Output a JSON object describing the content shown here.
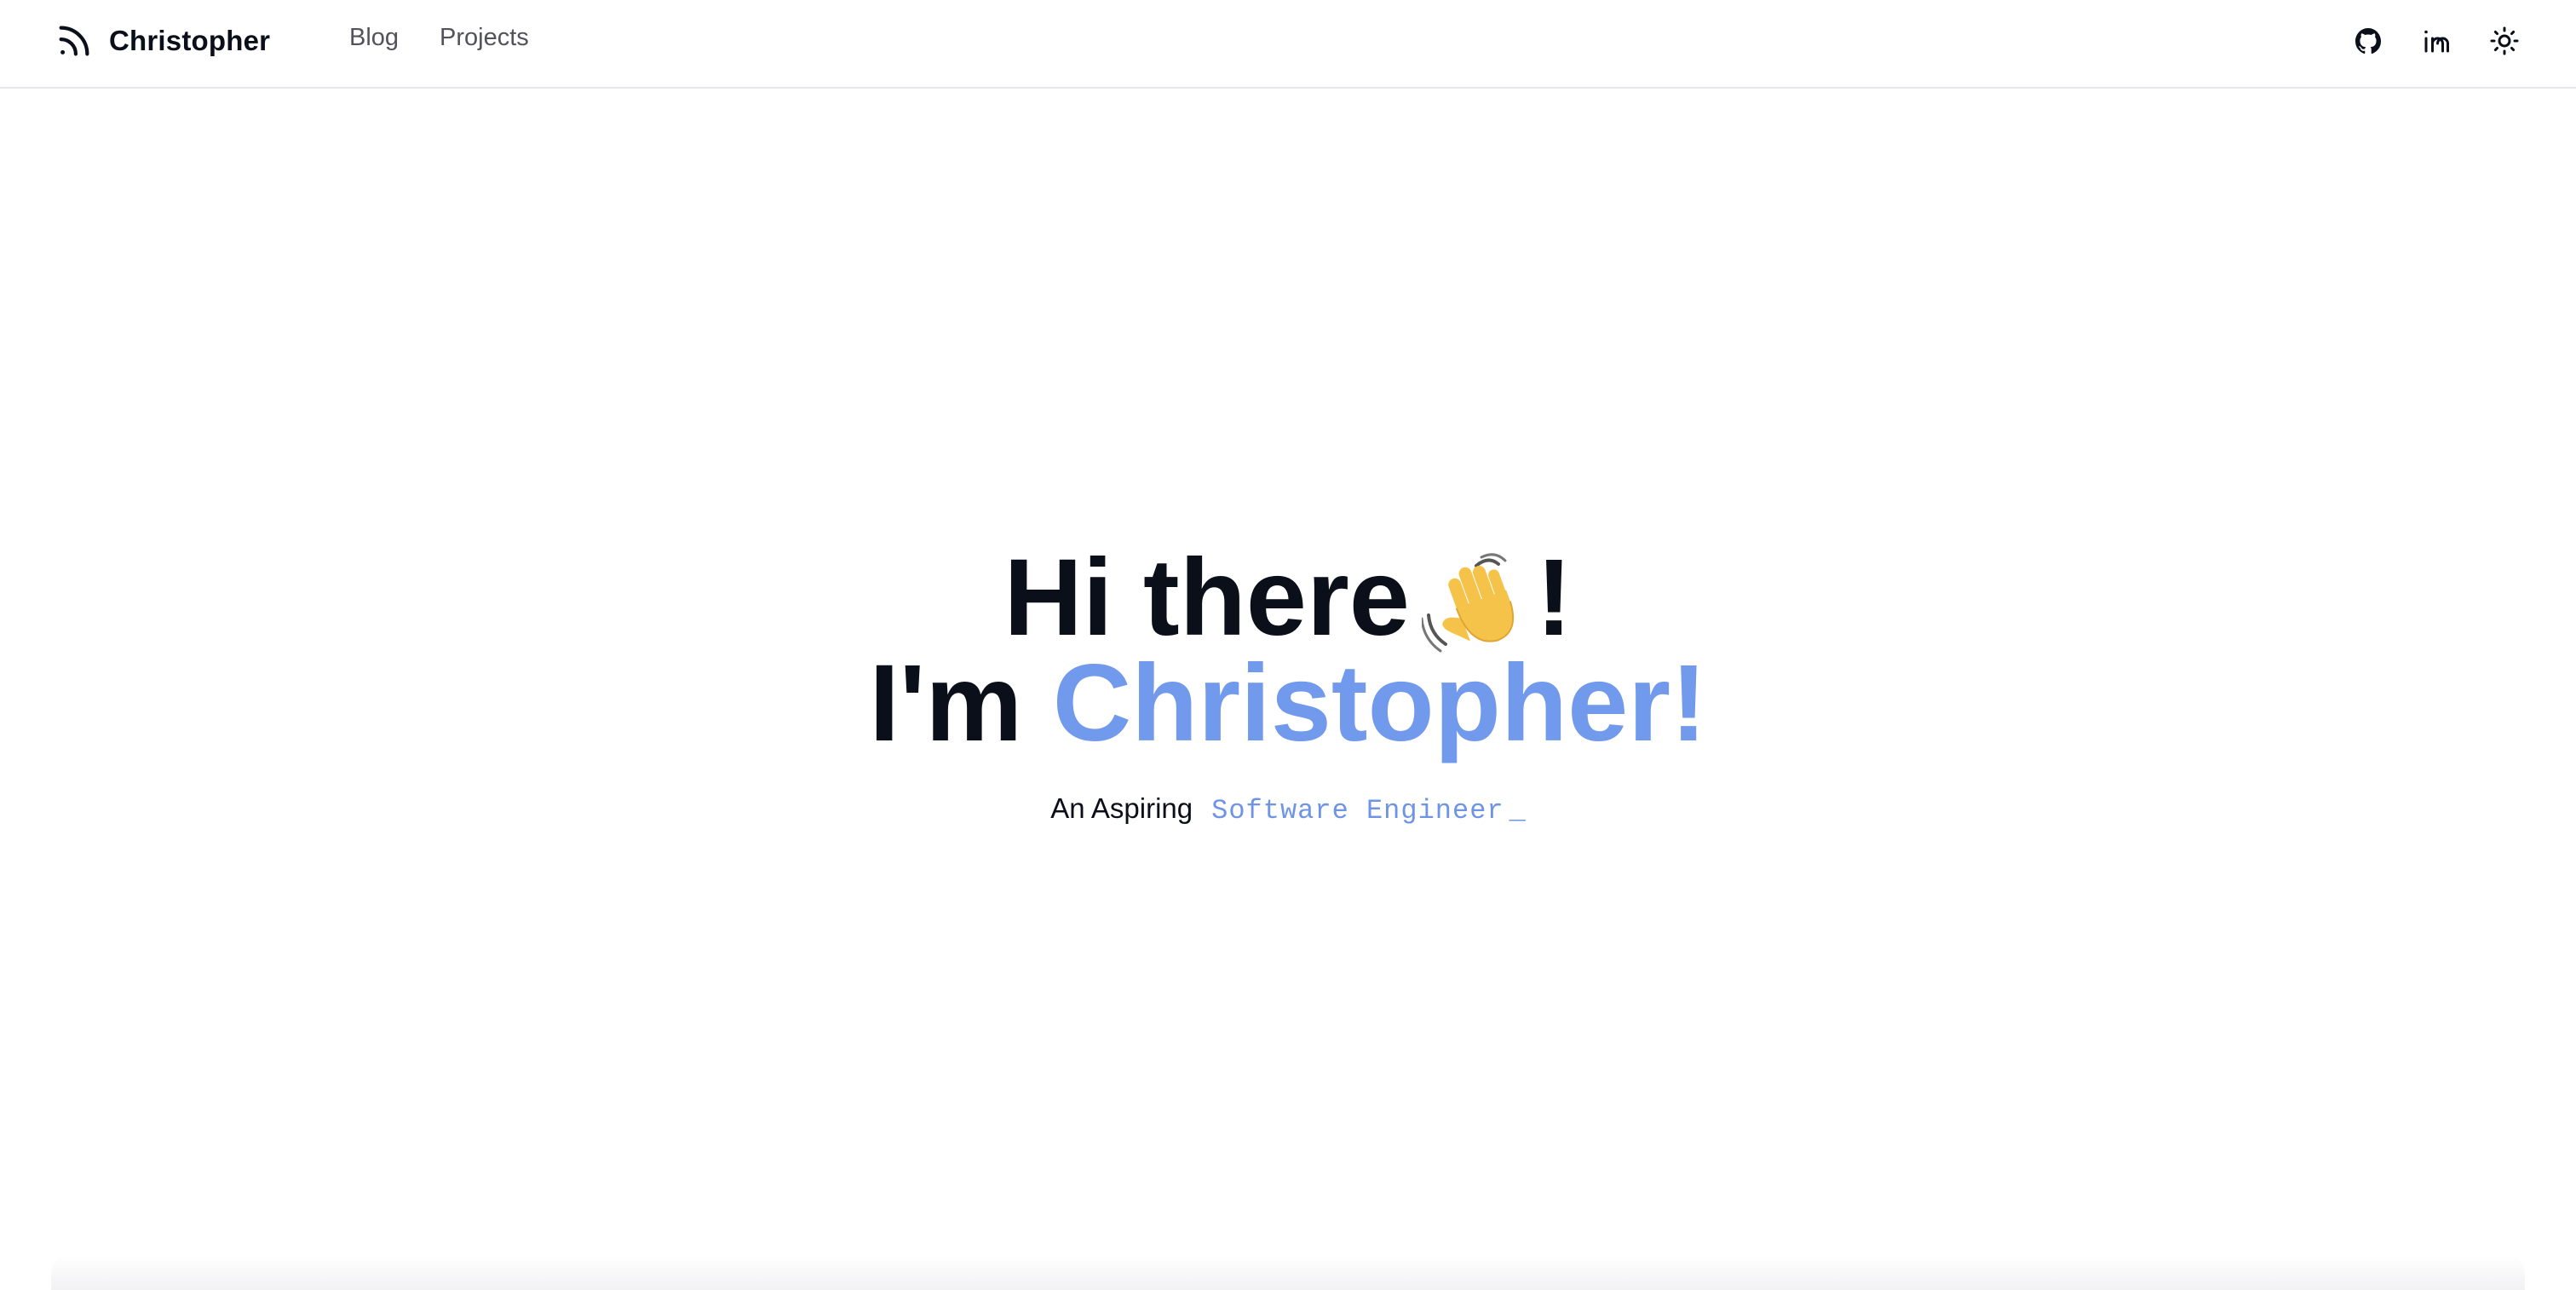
{
  "header": {
    "brand_name": "Christopher",
    "brand_icon": "rss-icon",
    "nav": [
      {
        "label": "Blog"
      },
      {
        "label": "Projects"
      }
    ],
    "actions": [
      {
        "icon": "github-icon"
      },
      {
        "icon": "linkedin-icon"
      },
      {
        "icon": "sun-icon"
      }
    ]
  },
  "hero": {
    "line1": "Hi there",
    "line1_end": "!",
    "wave_emoji": "waving-hand-icon",
    "line2_prefix": "I'm",
    "line2_name": "Christopher!",
    "tagline_prefix": "An Aspiring",
    "tagline_role": "Software Engineer",
    "cursor": "_"
  },
  "colors": {
    "accent": "#7199ec",
    "text": "#0b0f19",
    "nav_text": "#52525b",
    "border": "#e5e7eb"
  }
}
